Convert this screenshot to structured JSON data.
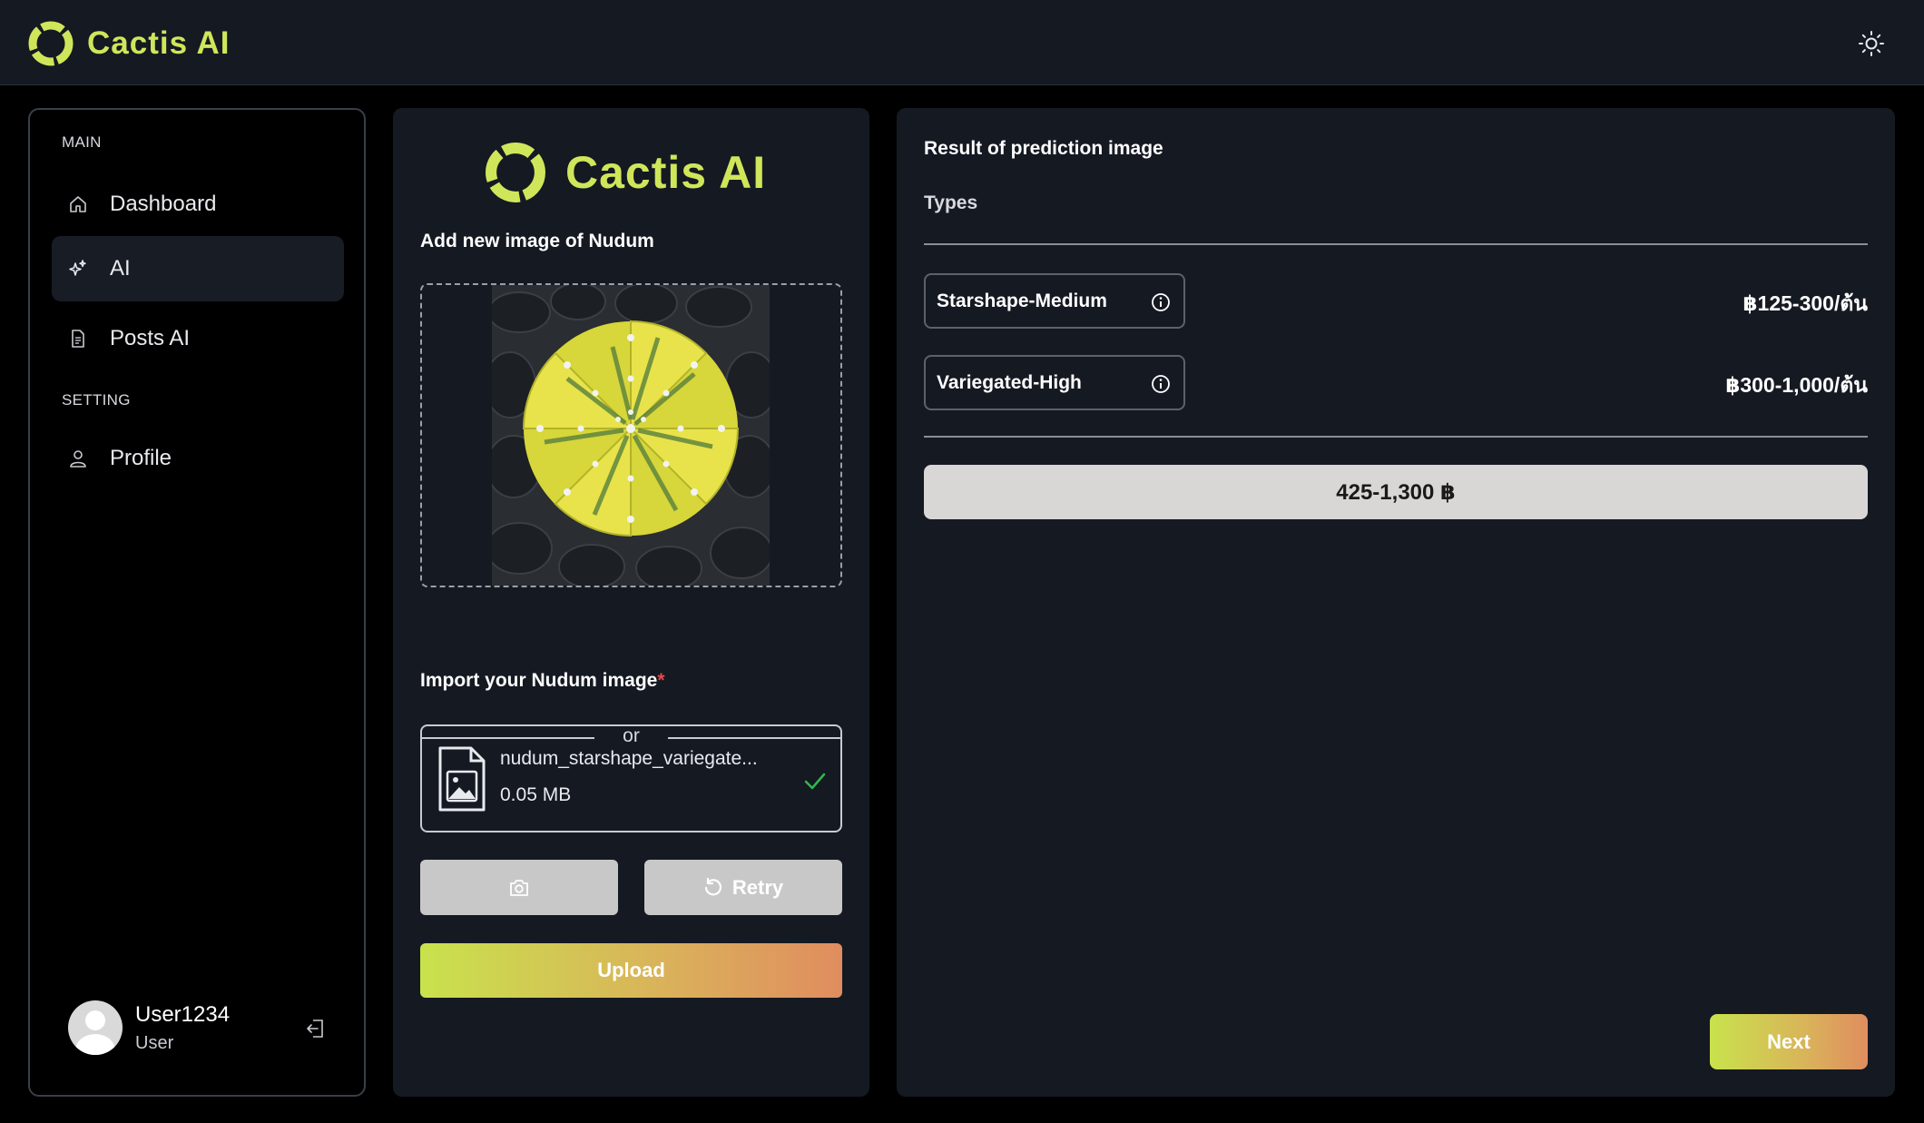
{
  "app": {
    "name": "Cactis AI",
    "accent": "#cfe65a"
  },
  "header": {
    "theme_icon": "sun-icon"
  },
  "sidebar": {
    "section_main": "MAIN",
    "section_setting": "SETTING",
    "items": [
      {
        "label": "Dashboard",
        "icon": "home-icon",
        "active": false
      },
      {
        "label": "AI",
        "icon": "sparkles-icon",
        "active": true
      },
      {
        "label": "Posts AI",
        "icon": "document-icon",
        "active": false
      },
      {
        "label": "Profile",
        "icon": "user-icon",
        "active": false
      }
    ],
    "user": {
      "name": "User1234",
      "role": "User"
    }
  },
  "upload": {
    "logo_text": "Cactis AI",
    "add_title": "Add new image of Nudum",
    "or_text": "or",
    "import_title": "Import your Nudum image",
    "required_mark": "*",
    "file": {
      "name": "nudum_starshape_variegate...",
      "size": "0.05 MB"
    },
    "camera_icon": "camera-icon",
    "retry_label": "Retry",
    "upload_label": "Upload"
  },
  "result": {
    "title": "Result of prediction image",
    "types_label": "Types",
    "types": [
      {
        "label": "Starshape-Medium",
        "price": "฿125-300/ต้น"
      },
      {
        "label": "Variegated-High",
        "price": "฿300-1,000/ต้น"
      }
    ],
    "total": "425-1,300 ฿",
    "next_label": "Next"
  }
}
